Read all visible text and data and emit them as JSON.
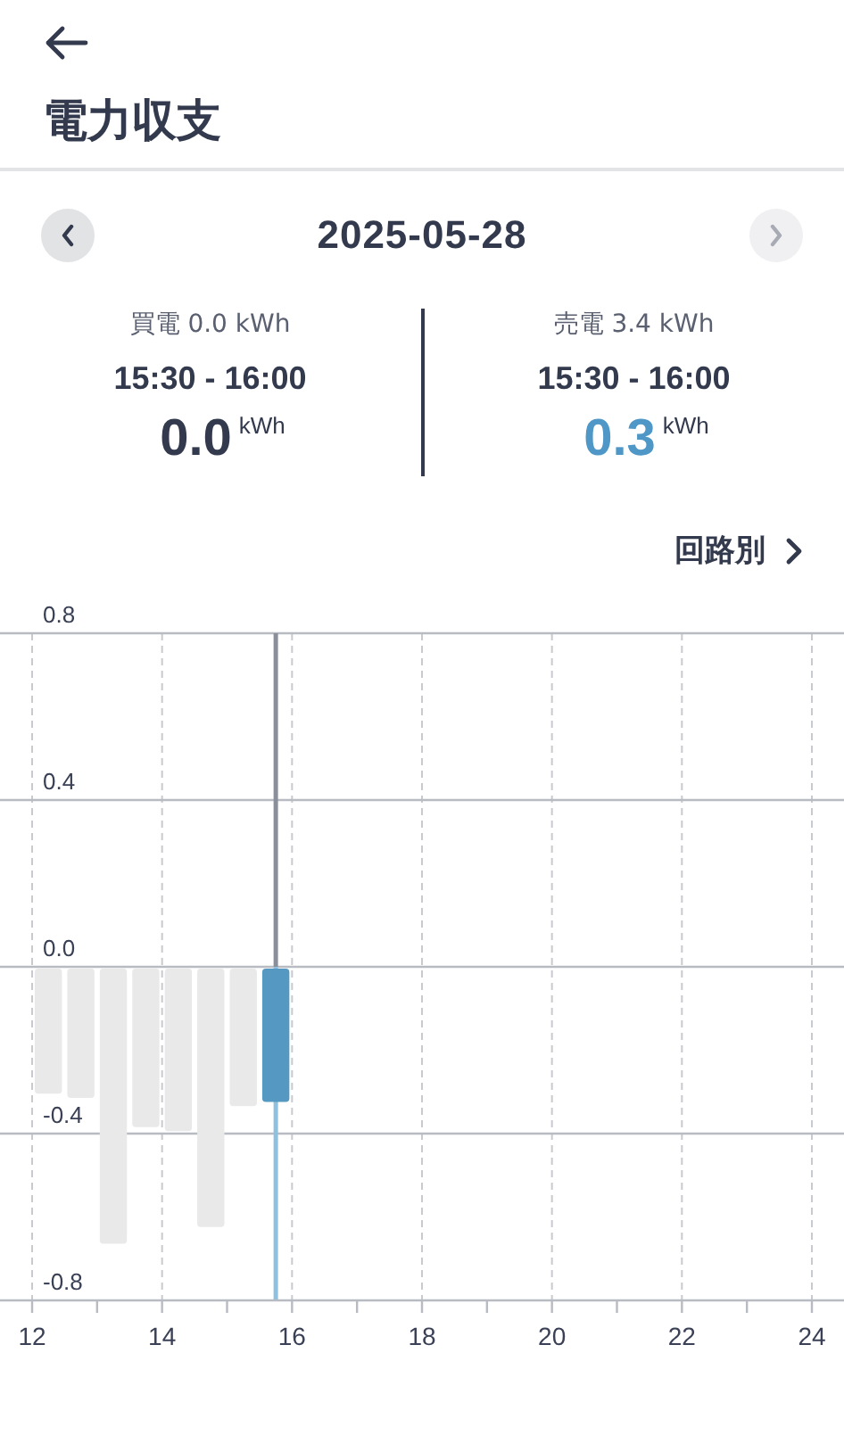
{
  "header": {
    "title": "電力収支"
  },
  "date_nav": {
    "date": "2025-05-28",
    "prev": {
      "disabled": false
    },
    "next": {
      "disabled": true
    }
  },
  "summary": [
    {
      "kind": "buy",
      "label": "買電 0.0 kWh",
      "time": "15:30 - 16:00",
      "value": "0.0",
      "unit": "kWh"
    },
    {
      "kind": "sell",
      "label": "売電 3.4 kWh",
      "time": "15:30 - 16:00",
      "value": "0.3",
      "unit": "kWh"
    }
  ],
  "circuit_link": {
    "label": "回路別"
  },
  "chart_data": {
    "type": "bar",
    "x": [
      12.25,
      12.75,
      13.25,
      13.75,
      14.25,
      14.75,
      15.25,
      15.75
    ],
    "series": [
      {
        "color": "#e9e9e9",
        "values": [
          -0.3,
          -0.31,
          -0.66,
          -0.38,
          -0.39,
          -0.62,
          -0.33,
          null
        ]
      },
      {
        "color": "#5598c2",
        "values": [
          null,
          null,
          null,
          null,
          null,
          null,
          null,
          -0.32
        ]
      }
    ],
    "stacked": true,
    "grid": true,
    "xlim": [
      12,
      24
    ],
    "ylim": [
      -0.8,
      0.8
    ],
    "xticks": [
      12,
      14,
      16,
      18,
      20,
      22,
      24
    ],
    "yticks": [
      -0.8,
      -0.4,
      {
        "value": 0,
        "label": "0.0"
      },
      0.4,
      0.8
    ],
    "ref_lines": [
      {
        "axis": "x",
        "value": 15.75,
        "color": "#8a8f9c"
      },
      {
        "axis": "x",
        "value": 15.75,
        "color": "#8fc0dd"
      }
    ]
  }
}
